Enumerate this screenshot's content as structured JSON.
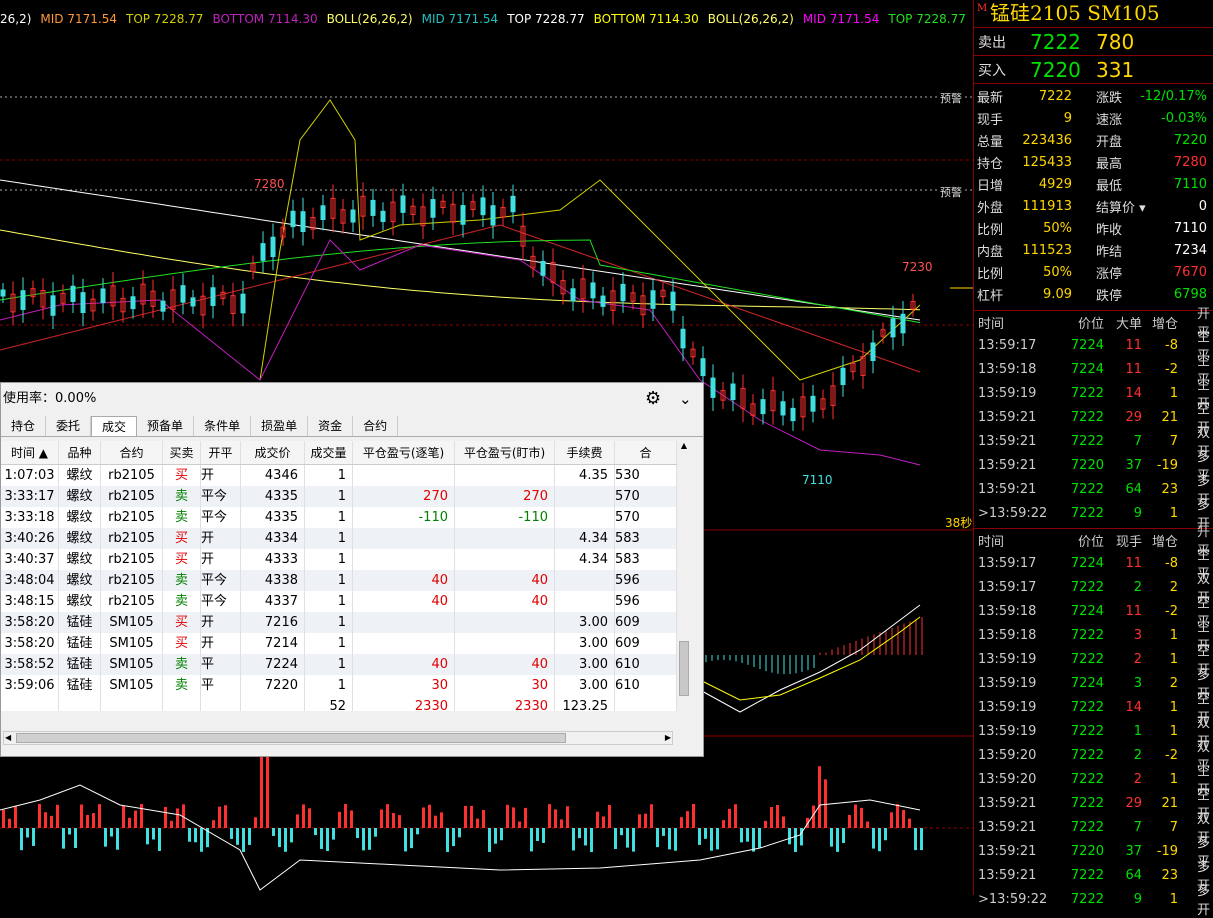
{
  "legend": [
    {
      "text": "26,2)",
      "color": "#ffffff"
    },
    {
      "text": "MID 7171.54",
      "color": "#ff9933"
    },
    {
      "text": "TOP 7228.77",
      "color": "#d0d000"
    },
    {
      "text": "BOTTOM 7114.30",
      "color": "#c020c0"
    },
    {
      "text": "BOLL(26,26,2)",
      "color": "#ffff66"
    },
    {
      "text": "MID 7171.54",
      "color": "#20c0c0"
    },
    {
      "text": "TOP 7228.77",
      "color": "#ffffff"
    },
    {
      "text": "BOTTOM 7114.30",
      "color": "#ffff00"
    },
    {
      "text": "BOLL(26,26,2)",
      "color": "#ffff66"
    },
    {
      "text": "MID 7171.54",
      "color": "#ff00ff"
    },
    {
      "text": "TOP 7228.77",
      "color": "#20e020"
    }
  ],
  "chart": {
    "alarm_label": "预警",
    "high_label": "7280",
    "last_high_label": "7230",
    "low_label": "7110",
    "countdown": "38秒"
  },
  "dialog": {
    "usage_label": "使用率：",
    "usage_value": "0.00%",
    "tabs": [
      "持仓",
      "委托",
      "成交",
      "预备单",
      "条件单",
      "损盈单",
      "资金",
      "合约"
    ],
    "active_tab": 2,
    "headers": [
      "时间 ▲",
      "品种",
      "合约",
      "买卖",
      "开平",
      "成交价",
      "成交量",
      "平仓盈亏(逐笔)",
      "平仓盈亏(盯市)",
      "手续费",
      "合"
    ],
    "rows": [
      [
        "1:07:03",
        "螺纹",
        "rb2105",
        "买",
        "开",
        "4346",
        "1",
        "",
        "",
        "4.35",
        "530"
      ],
      [
        "3:33:17",
        "螺纹",
        "rb2105",
        "卖",
        "平今",
        "4335",
        "1",
        "270",
        "270",
        "",
        "570"
      ],
      [
        "3:33:18",
        "螺纹",
        "rb2105",
        "卖",
        "平今",
        "4335",
        "1",
        "-110",
        "-110",
        "",
        "570"
      ],
      [
        "3:40:26",
        "螺纹",
        "rb2105",
        "买",
        "开",
        "4334",
        "1",
        "",
        "",
        "4.34",
        "583"
      ],
      [
        "3:40:37",
        "螺纹",
        "rb2105",
        "买",
        "开",
        "4333",
        "1",
        "",
        "",
        "4.34",
        "583"
      ],
      [
        "3:48:04",
        "螺纹",
        "rb2105",
        "卖",
        "平今",
        "4338",
        "1",
        "40",
        "40",
        "",
        "596"
      ],
      [
        "3:48:15",
        "螺纹",
        "rb2105",
        "卖",
        "平今",
        "4337",
        "1",
        "40",
        "40",
        "",
        "596"
      ],
      [
        "3:58:20",
        "锰硅",
        "SM105",
        "买",
        "开",
        "7216",
        "1",
        "",
        "",
        "3.00",
        "609"
      ],
      [
        "3:58:20",
        "锰硅",
        "SM105",
        "买",
        "开",
        "7214",
        "1",
        "",
        "",
        "3.00",
        "609"
      ],
      [
        "3:58:52",
        "锰硅",
        "SM105",
        "卖",
        "平",
        "7224",
        "1",
        "40",
        "40",
        "3.00",
        "610"
      ],
      [
        "3:59:06",
        "锰硅",
        "SM105",
        "卖",
        "平",
        "7220",
        "1",
        "30",
        "30",
        "3.00",
        "610"
      ]
    ],
    "total": {
      "volume": "52",
      "pl1": "2330",
      "pl2": "2330",
      "fee": "123.25"
    }
  },
  "panel": {
    "marker": "M",
    "title": "锰硅2105  SM105",
    "ask": {
      "label": "卖出",
      "price": "7222",
      "vol": "780"
    },
    "bid": {
      "label": "买入",
      "price": "7220",
      "vol": "331"
    },
    "stats": [
      [
        "最新",
        "7222",
        "涨跌",
        "-12/0.17%"
      ],
      [
        "现手",
        "9",
        "速涨",
        "-0.03%"
      ],
      [
        "总量",
        "223436",
        "开盘",
        "7220"
      ],
      [
        "持仓",
        "125433",
        "最高",
        "7280"
      ],
      [
        "日增",
        "4929",
        "最低",
        "7110"
      ],
      [
        "外盘",
        "111913",
        "结算价 ▾",
        "0"
      ],
      [
        "比例",
        "50%",
        "昨收",
        "7110"
      ],
      [
        "内盘",
        "111523",
        "昨结",
        "7234"
      ],
      [
        "比例",
        "50%",
        "涨停",
        "7670"
      ],
      [
        "杠杆",
        "9.09",
        "跌停",
        "6798"
      ]
    ],
    "tick_headers1": [
      "时间",
      "价位",
      "大单",
      "增仓",
      "开平"
    ],
    "ticks1": [
      [
        "13:59:17",
        "7224",
        "11",
        "-8",
        "空平"
      ],
      [
        "13:59:18",
        "7224",
        "11",
        "-2",
        "空平"
      ],
      [
        "13:59:19",
        "7222",
        "14",
        "1",
        "空开"
      ],
      [
        "13:59:21",
        "7222",
        "29",
        "21",
        "空开"
      ],
      [
        "13:59:21",
        "7222",
        "7",
        "7",
        "双开"
      ],
      [
        "13:59:21",
        "7220",
        "37",
        "-19",
        "多平"
      ],
      [
        "13:59:21",
        "7222",
        "64",
        "23",
        "多开"
      ],
      [
        ">13:59:22",
        "7222",
        "9",
        "1",
        "多开"
      ]
    ],
    "tick_headers2": [
      "时间",
      "价位",
      "现手",
      "增仓",
      "开平"
    ],
    "ticks2": [
      [
        "13:59:17",
        "7224",
        "11",
        "-8",
        "空平"
      ],
      [
        "13:59:17",
        "7222",
        "2",
        "2",
        "双开"
      ],
      [
        "13:59:18",
        "7224",
        "11",
        "-2",
        "空平"
      ],
      [
        "13:59:18",
        "7222",
        "3",
        "1",
        "空开"
      ],
      [
        "13:59:19",
        "7222",
        "2",
        "1",
        "空开"
      ],
      [
        "13:59:19",
        "7224",
        "3",
        "2",
        "多开"
      ],
      [
        "13:59:19",
        "7222",
        "14",
        "1",
        "空开"
      ],
      [
        "13:59:19",
        "7222",
        "1",
        "1",
        "双开"
      ],
      [
        "13:59:20",
        "7222",
        "2",
        "-2",
        "双平"
      ],
      [
        "13:59:20",
        "7222",
        "2",
        "1",
        "空开"
      ],
      [
        "13:59:21",
        "7222",
        "29",
        "21",
        "空开"
      ],
      [
        "13:59:21",
        "7222",
        "7",
        "7",
        "双开"
      ],
      [
        "13:59:21",
        "7220",
        "37",
        "-19",
        "多平"
      ],
      [
        "13:59:21",
        "7222",
        "64",
        "23",
        "多开"
      ],
      [
        ">13:59:22",
        "7222",
        "9",
        "1",
        "多开"
      ]
    ]
  }
}
